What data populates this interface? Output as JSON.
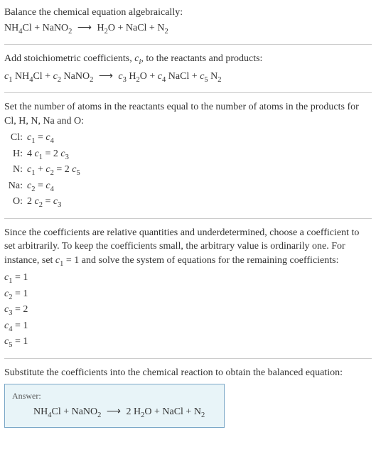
{
  "header": {
    "prompt": "Balance the chemical equation algebraically:",
    "equation_lhs": "NH₄Cl + NaNO₂",
    "equation_rhs": "H₂O + NaCl + N₂"
  },
  "stoich": {
    "intro": "Add stoichiometric coefficients, cᵢ, to the reactants and products:",
    "eq_lhs_c1": "c₁",
    "eq_lhs_sp1": "NH₄Cl",
    "eq_lhs_plus": "+",
    "eq_lhs_c2": "c₂",
    "eq_lhs_sp2": "NaNO₂",
    "eq_rhs_c3": "c₃",
    "eq_rhs_sp3": "H₂O",
    "eq_rhs_c4": "c₄",
    "eq_rhs_sp4": "NaCl",
    "eq_rhs_c5": "c₅",
    "eq_rhs_sp5": "N₂"
  },
  "atoms": {
    "intro": "Set the number of atoms in the reactants equal to the number of atoms in the products for Cl, H, N, Na and O:",
    "rows": [
      {
        "label": "Cl:",
        "eq": "c₁ = c₄"
      },
      {
        "label": "H:",
        "eq": "4 c₁ = 2 c₃"
      },
      {
        "label": "N:",
        "eq": "c₁ + c₂ = 2 c₅"
      },
      {
        "label": "Na:",
        "eq": "c₂ = c₄"
      },
      {
        "label": "O:",
        "eq": "2 c₂ = c₃"
      }
    ]
  },
  "solve": {
    "intro": "Since the coefficients are relative quantities and underdetermined, choose a coefficient to set arbitrarily. To keep the coefficients small, the arbitrary value is ordinarily one. For instance, set c₁ = 1 and solve the system of equations for the remaining coefficients:",
    "coefs": [
      "c₁ = 1",
      "c₂ = 1",
      "c₃ = 2",
      "c₄ = 1",
      "c₅ = 1"
    ]
  },
  "substitute": {
    "intro": "Substitute the coefficients into the chemical reaction to obtain the balanced equation:"
  },
  "answer": {
    "label": "Answer:",
    "eq_lhs": "NH₄Cl + NaNO₂",
    "eq_rhs": "2 H₂O + NaCl + N₂"
  },
  "arrow": "⟶",
  "chart_data": {
    "type": "table",
    "title": "Atom balance equations",
    "rows": [
      {
        "element": "Cl",
        "equation": "c1 = c4"
      },
      {
        "element": "H",
        "equation": "4 c1 = 2 c3"
      },
      {
        "element": "N",
        "equation": "c1 + c2 = 2 c5"
      },
      {
        "element": "Na",
        "equation": "c2 = c4"
      },
      {
        "element": "O",
        "equation": "2 c2 = c3"
      }
    ],
    "solution": {
      "c1": 1,
      "c2": 1,
      "c3": 2,
      "c4": 1,
      "c5": 1
    },
    "balanced_equation": "NH4Cl + NaNO2 -> 2 H2O + NaCl + N2"
  }
}
